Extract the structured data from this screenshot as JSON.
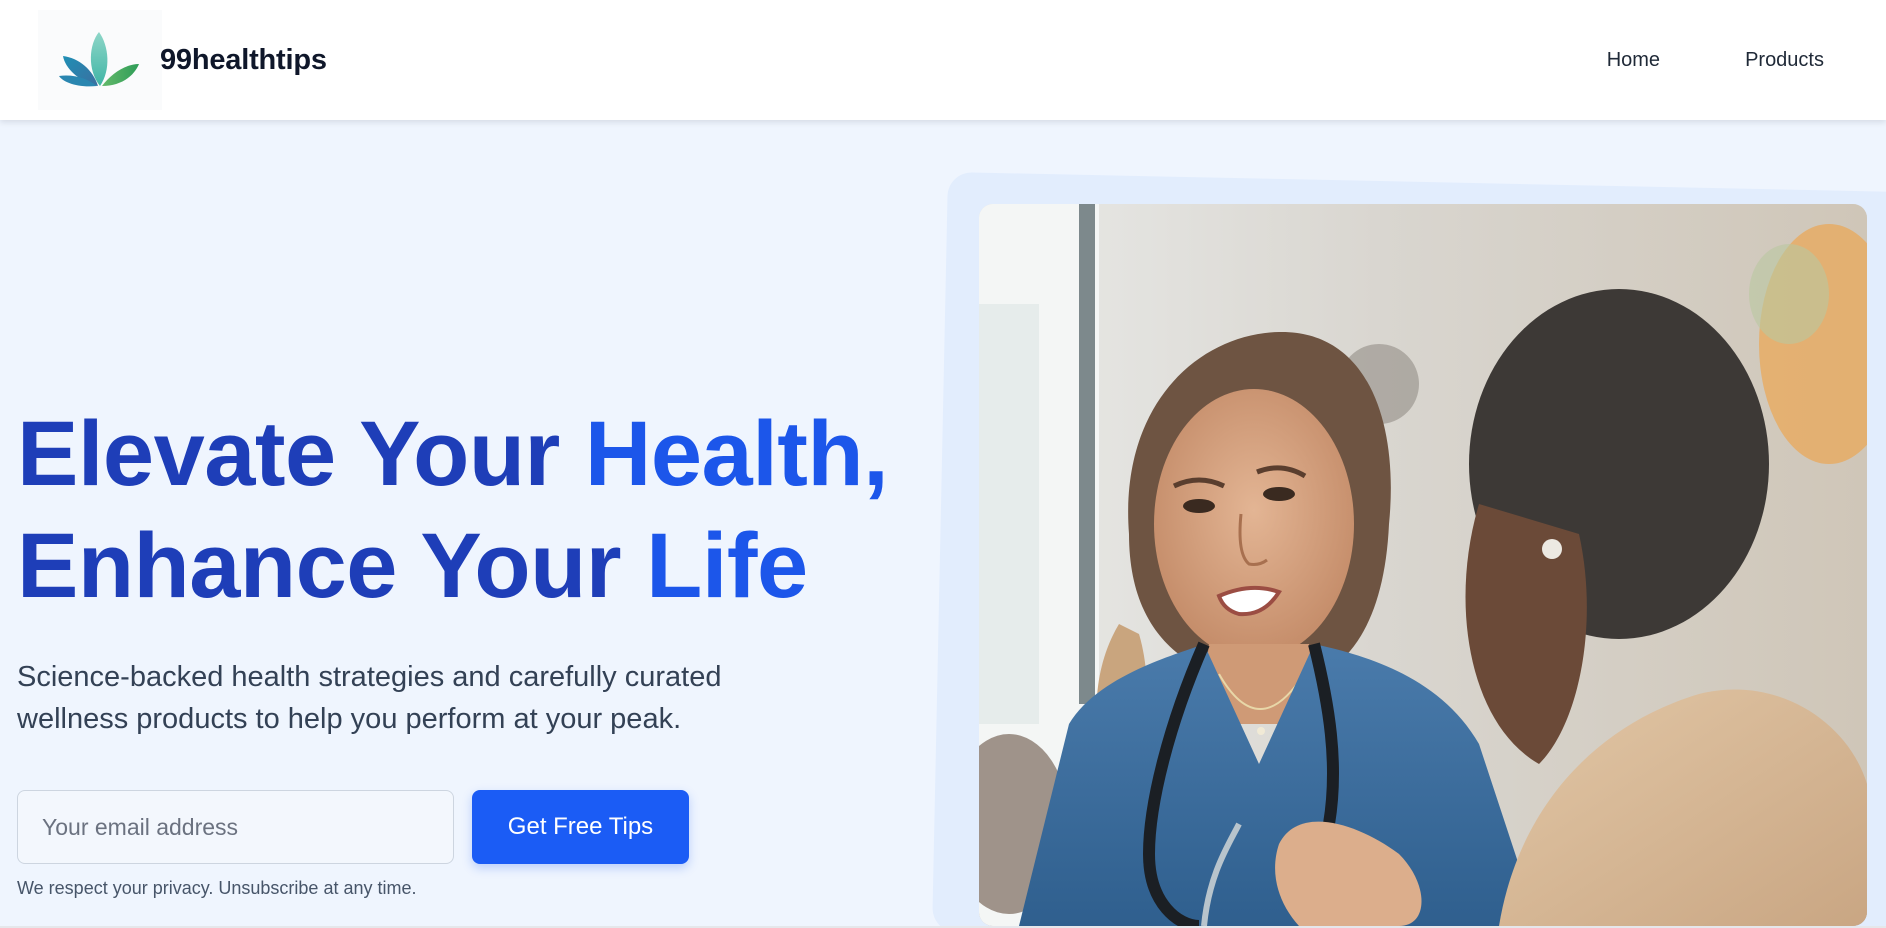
{
  "brand": {
    "name": "99healthtips",
    "logo_icon": "lotus-leaf-icon",
    "colors": {
      "leaf_teal": "#2a9bb8",
      "leaf_green": "#5bb55a"
    }
  },
  "nav": {
    "items": [
      {
        "label": "Home"
      },
      {
        "label": "Products"
      }
    ]
  },
  "hero": {
    "title": {
      "line1_dark": "Elevate Your ",
      "line1_accent": "Health,",
      "line2_dark": "Enhance Your ",
      "line2_accent": "Life"
    },
    "subtitle": "Science-backed health strategies and carefully curated wellness products to help you perform at your peak.",
    "email_placeholder": "Your email address",
    "email_value": "",
    "cta_label": "Get Free Tips",
    "privacy_note": "We respect your privacy. Unsubscribe at any time.",
    "image_subject": "nurse-talking-with-patient-photo"
  },
  "colors": {
    "page_bg": "#eff5fe",
    "title_dark": "#1e3eb8",
    "title_accent": "#1c56ea",
    "button_bg": "#1b5cf5"
  }
}
